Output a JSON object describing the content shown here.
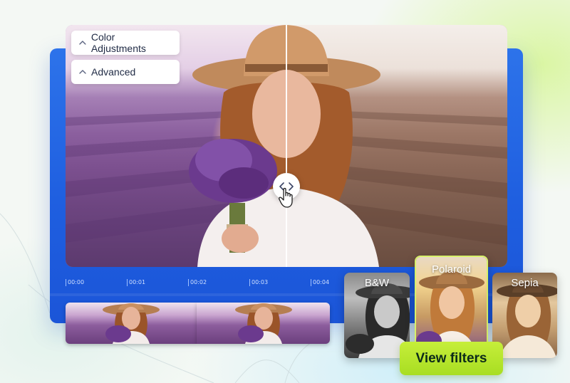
{
  "panels": {
    "color_adjustments": "Color Adjustments",
    "advanced": "Advanced"
  },
  "timeline": {
    "ticks": [
      "00:00",
      "00:01",
      "00:02",
      "00:03",
      "00:04"
    ]
  },
  "filters": {
    "bw": "B&W",
    "polaroid": "Polaroid",
    "sepia": "Sepia",
    "selected": "Polaroid"
  },
  "actions": {
    "view_filters": "View filters"
  },
  "icons": {
    "compare_handle": "chevron-left-right-icon",
    "cursor": "hand-pointer-icon",
    "panel_toggle": "chevron-up-icon"
  },
  "colors": {
    "panel_blue": "#1f5fe0",
    "accent_green": "#b5e62c",
    "text_dark": "#1f2a44"
  }
}
